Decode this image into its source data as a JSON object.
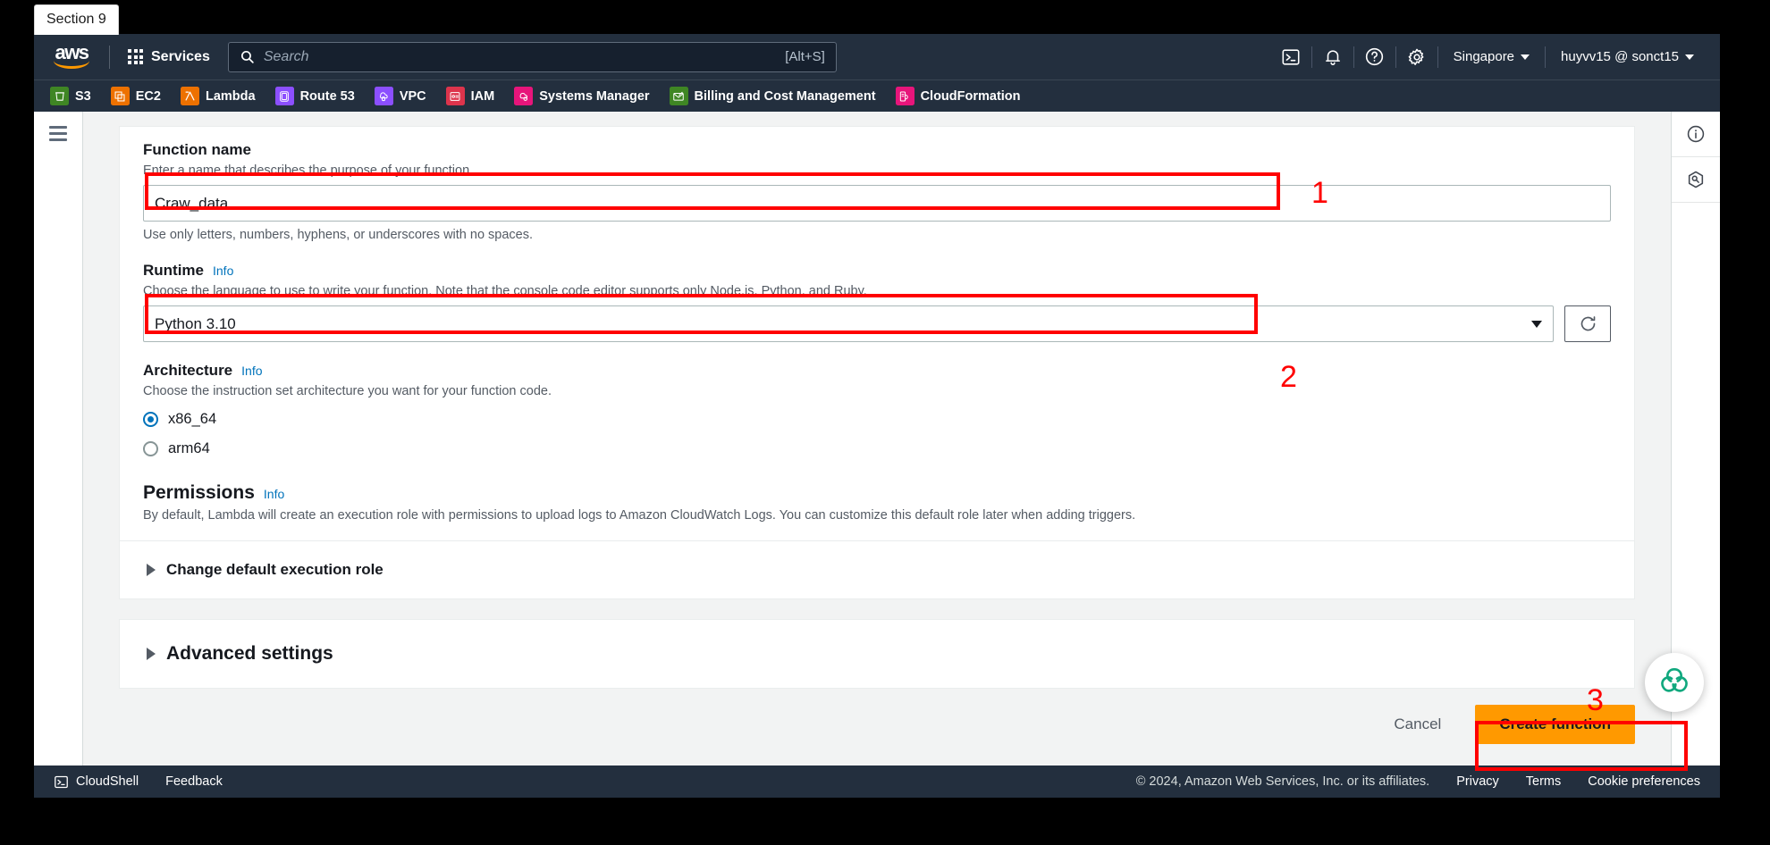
{
  "window": {
    "section_tab": "Section 9"
  },
  "topnav": {
    "logo_text": "aws",
    "services_label": "Services",
    "search": {
      "placeholder": "Search",
      "shortcut": "[Alt+S]",
      "icon": "search-icon"
    },
    "icons": [
      {
        "name": "cloudshell-icon",
        "glyph": ">_"
      },
      {
        "name": "notifications-bell-icon",
        "glyph": "bell"
      },
      {
        "name": "help-question-icon",
        "glyph": "?"
      },
      {
        "name": "settings-gear-icon",
        "glyph": "gear"
      }
    ],
    "region": "Singapore",
    "account": "huyvv15 @ sonct15"
  },
  "shortcuts": [
    {
      "label": "S3",
      "color": "#3f8624",
      "icon": "s3-bucket-icon"
    },
    {
      "label": "EC2",
      "color": "#ed7100",
      "icon": "ec2-instance-icon"
    },
    {
      "label": "Lambda",
      "color": "#ed7100",
      "icon": "lambda-icon"
    },
    {
      "label": "Route 53",
      "color": "#8c4fff",
      "icon": "route53-icon"
    },
    {
      "label": "VPC",
      "color": "#8c4fff",
      "icon": "vpc-icon"
    },
    {
      "label": "IAM",
      "color": "#dd344c",
      "icon": "iam-icon"
    },
    {
      "label": "Systems Manager",
      "color": "#e7157b",
      "icon": "systems-manager-icon"
    },
    {
      "label": "Billing and Cost Management",
      "color": "#3f8624",
      "icon": "billing-icon"
    },
    {
      "label": "CloudFormation",
      "color": "#e7157b",
      "icon": "cloudformation-icon"
    }
  ],
  "form": {
    "function_name": {
      "label": "Function name",
      "description": "Enter a name that describes the purpose of your function.",
      "value": "Craw_data",
      "placeholder": "",
      "hint": "Use only letters, numbers, hyphens, or underscores with no spaces."
    },
    "runtime": {
      "label": "Runtime",
      "info": "Info",
      "description": "Choose the language to use to write your function. Note that the console code editor supports only Node.js, Python, and Ruby.",
      "value": "Python 3.10",
      "refresh_icon": "refresh-icon"
    },
    "architecture": {
      "label": "Architecture",
      "info": "Info",
      "description": "Choose the instruction set architecture you want for your function code.",
      "options": [
        {
          "label": "x86_64",
          "selected": true
        },
        {
          "label": "arm64",
          "selected": false
        }
      ]
    },
    "permissions": {
      "label": "Permissions",
      "info": "Info",
      "description": "By default, Lambda will create an execution role with permissions to upload logs to Amazon CloudWatch Logs. You can customize this default role later when adding triggers.",
      "expander": "Change default execution role"
    },
    "advanced_settings": {
      "label": "Advanced settings"
    }
  },
  "actions": {
    "cancel": "Cancel",
    "create": "Create function"
  },
  "annotations": [
    {
      "number": "1",
      "target": "function-name-input"
    },
    {
      "number": "2",
      "target": "runtime-select"
    },
    {
      "number": "3",
      "target": "create-function-button"
    }
  ],
  "right_rail": [
    {
      "name": "info-panel-icon"
    },
    {
      "name": "shortcuts-hexagon-icon"
    }
  ],
  "footer": {
    "cloudshell": "CloudShell",
    "feedback": "Feedback",
    "copyright": "© 2024, Amazon Web Services, Inc. or its affiliates.",
    "links": [
      "Privacy",
      "Terms",
      "Cookie preferences"
    ]
  },
  "colors": {
    "nav_bg": "#232f3e",
    "accent_orange": "#ff9900",
    "link_blue": "#0073bb",
    "annotation_red": "#ff0000"
  }
}
